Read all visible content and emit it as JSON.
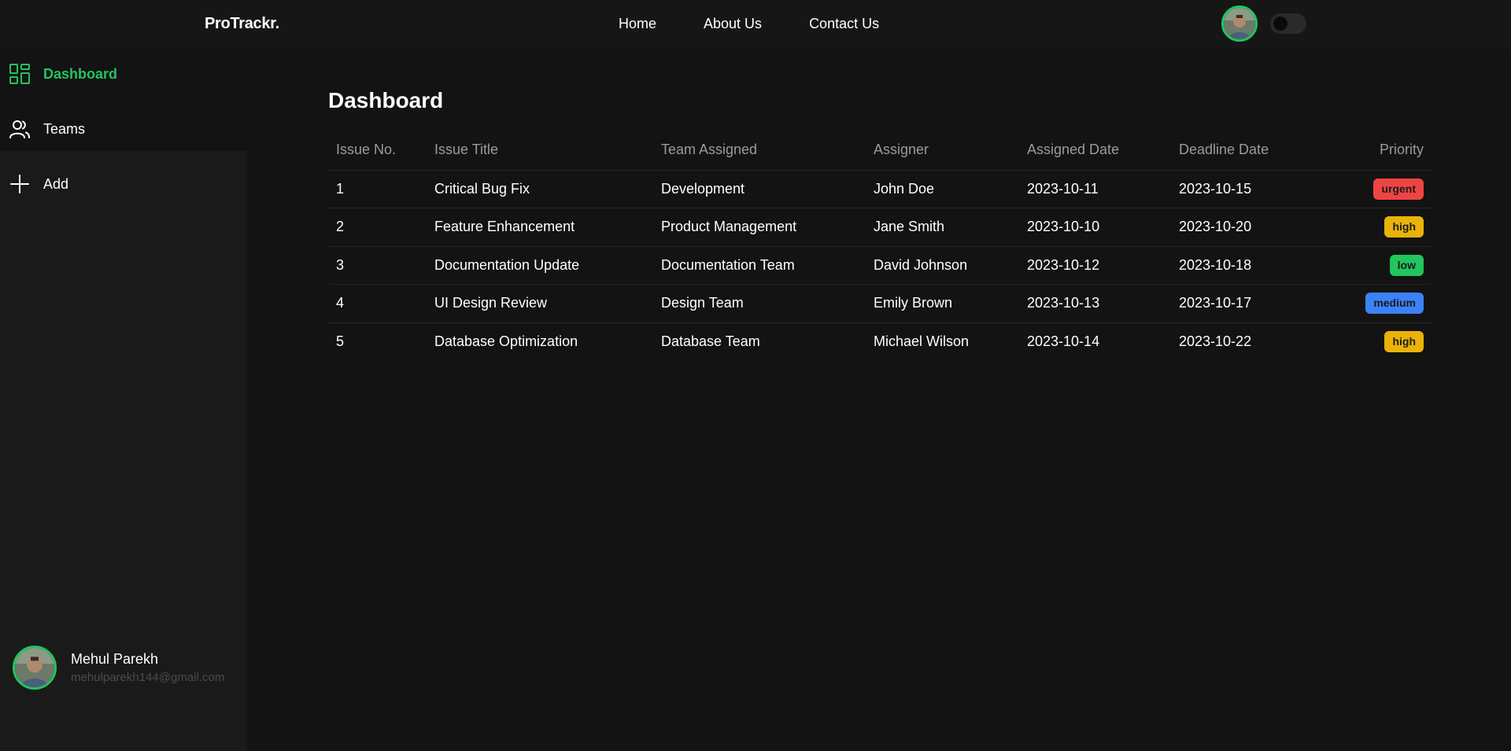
{
  "header": {
    "brand": "ProTrackr.",
    "nav": [
      {
        "label": "Home"
      },
      {
        "label": "About Us"
      },
      {
        "label": "Contact Us"
      }
    ]
  },
  "sidebar": {
    "items": [
      {
        "label": "Dashboard",
        "icon": "dashboard-grid-icon",
        "active": true
      },
      {
        "label": "Teams",
        "icon": "users-icon",
        "active": false
      },
      {
        "label": "Add",
        "icon": "plus-icon",
        "active": false
      }
    ],
    "user": {
      "name": "Mehul Parekh",
      "email": "mehulparekh144@gmail.com"
    }
  },
  "main": {
    "title": "Dashboard",
    "table": {
      "columns": [
        "Issue No.",
        "Issue Title",
        "Team Assigned",
        "Assigner",
        "Assigned Date",
        "Deadline Date",
        "Priority"
      ],
      "rows": [
        {
          "no": "1",
          "title": "Critical Bug Fix",
          "team": "Development",
          "assigner": "John Doe",
          "assigned": "2023-10-11",
          "deadline": "2023-10-15",
          "priority": "urgent"
        },
        {
          "no": "2",
          "title": "Feature Enhancement",
          "team": "Product Management",
          "assigner": "Jane Smith",
          "assigned": "2023-10-10",
          "deadline": "2023-10-20",
          "priority": "high"
        },
        {
          "no": "3",
          "title": "Documentation Update",
          "team": "Documentation Team",
          "assigner": "David Johnson",
          "assigned": "2023-10-12",
          "deadline": "2023-10-18",
          "priority": "low"
        },
        {
          "no": "4",
          "title": "UI Design Review",
          "team": "Design Team",
          "assigner": "Emily Brown",
          "assigned": "2023-10-13",
          "deadline": "2023-10-17",
          "priority": "medium"
        },
        {
          "no": "5",
          "title": "Database Optimization",
          "team": "Database Team",
          "assigner": "Michael Wilson",
          "assigned": "2023-10-14",
          "deadline": "2023-10-22",
          "priority": "high"
        }
      ]
    }
  },
  "colors": {
    "accent": "#22c55e",
    "priority": {
      "urgent": "#ef4444",
      "high": "#eab308",
      "low": "#22c55e",
      "medium": "#3b82f6"
    }
  }
}
